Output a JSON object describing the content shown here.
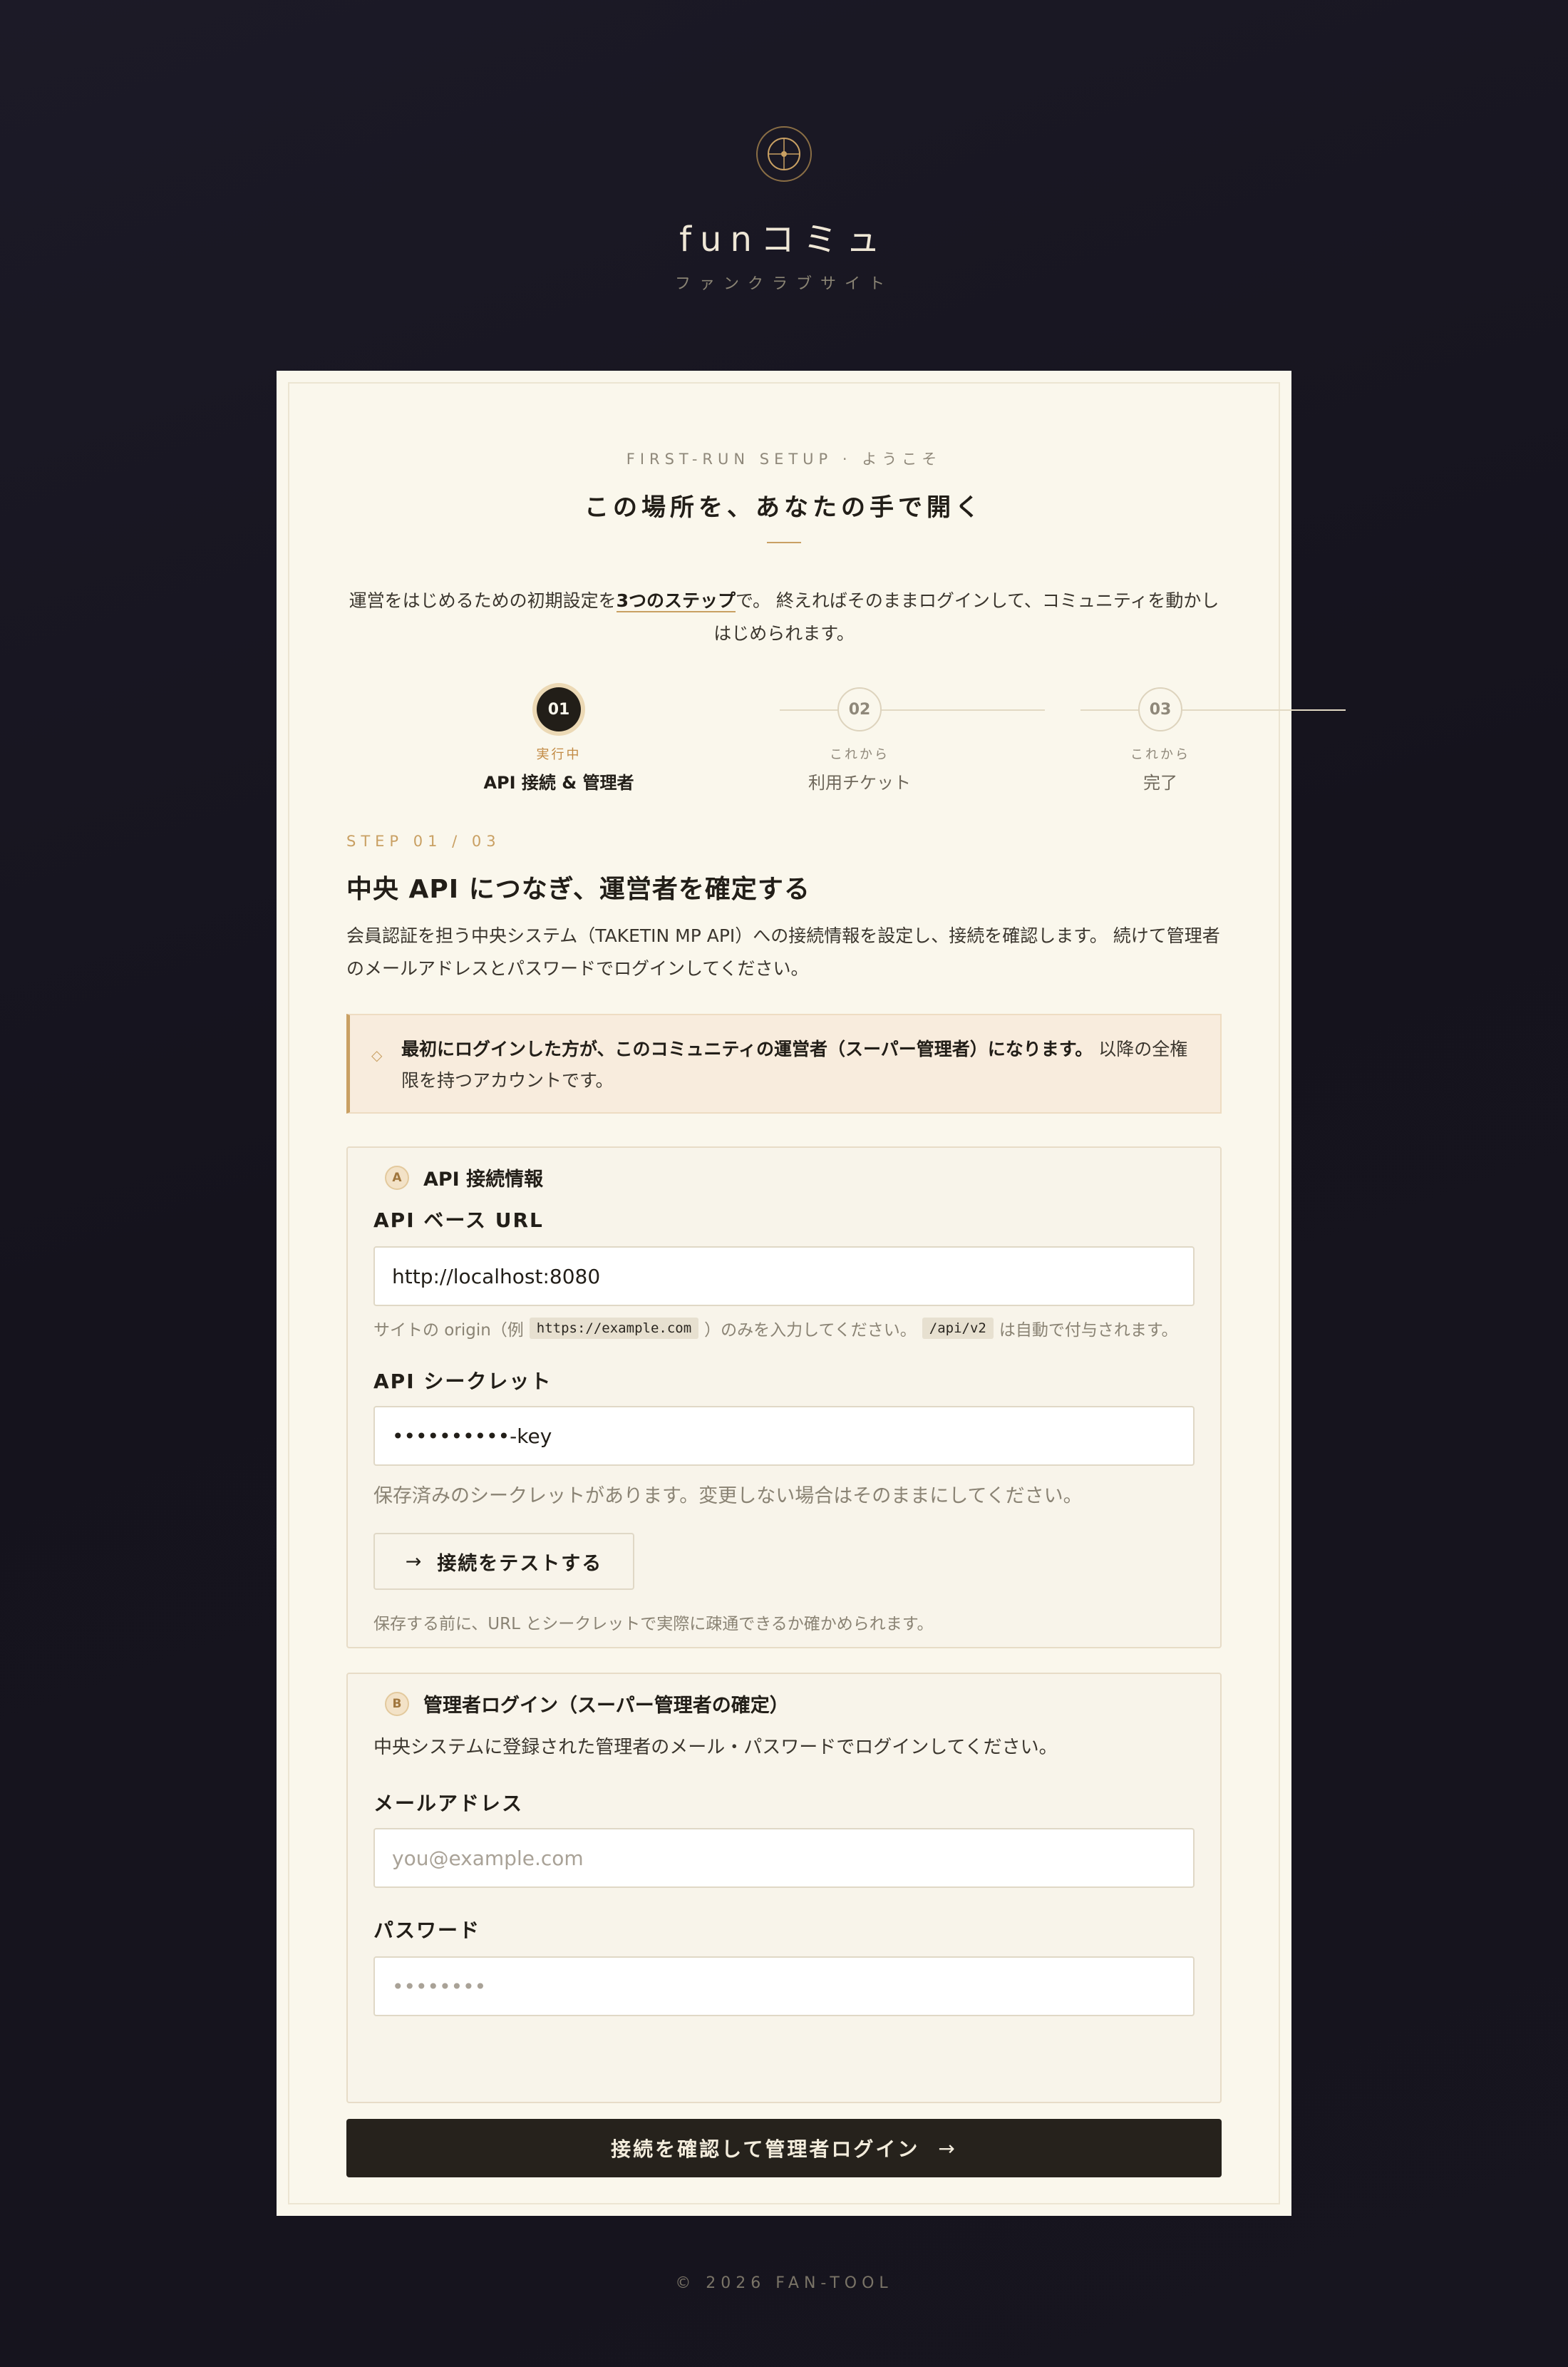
{
  "brand": {
    "name": "funコミュ",
    "subtitle": "ファンクラブサイト",
    "logo_icon": "crosshair-circle-icon"
  },
  "header": {
    "eyebrow": "FIRST-RUN SETUP · ようこそ",
    "title": "この場所を、あなたの手で開く",
    "intro_before": "運営をはじめるための初期設定を",
    "intro_strong": "3つのステップ",
    "intro_after": "で。 終えればそのままログインして、コミュニティを動かしはじめられます。"
  },
  "steps": [
    {
      "number": "01",
      "state": "実行中",
      "label": "API 接続 & 管理者",
      "active": true
    },
    {
      "number": "02",
      "state": "これから",
      "label": "利用チケット",
      "active": false
    },
    {
      "number": "03",
      "state": "これから",
      "label": "完了",
      "active": false
    }
  ],
  "section": {
    "step_label": "STEP 01 / 03",
    "title": "中央 API につなぎ、運営者を確定する",
    "description": "会員認証を担う中央システム（TAKETIN MP API）への接続情報を設定し、接続を確認します。 続けて管理者のメールアドレスとパスワードでログインしてください。"
  },
  "notice": {
    "icon": "diamond-icon",
    "strong": "最初にログインした方が、このコミュニティの運営者（スーパー管理者）になります。",
    "text": " 以降の全権限を持つアカウントです。"
  },
  "api_panel": {
    "badge": "A",
    "title": "API 接続情報",
    "base_url_label": "API ベース URL",
    "base_url_value": "http://localhost:8080",
    "hint_before": "サイトの origin（例",
    "hint_code1": "https://example.com",
    "hint_middle": "）のみを入力してください。",
    "hint_code2": "/api/v2",
    "hint_after": "は自動で付与されます。",
    "secret_label": "API シークレット",
    "secret_value": "••••••••••-key",
    "secret_hint": "保存済みのシークレットがあります。変更しない場合はそのままにしてください。",
    "test_button": "接続をテストする",
    "test_icon": "arrow-right-icon",
    "test_hint": "保存する前に、URL とシークレットで実際に疎通できるか確かめられます。"
  },
  "admin_panel": {
    "badge": "B",
    "title": "管理者ログイン（スーパー管理者の確定）",
    "description": "中央システムに登録された管理者のメール・パスワードでログインしてください。",
    "email_label": "メールアドレス",
    "email_placeholder": "you@example.com",
    "password_label": "パスワード",
    "password_placeholder": "••••••••"
  },
  "submit": {
    "label": "接続を確認して管理者ログイン",
    "icon": "arrow-right-icon"
  },
  "footer": {
    "text": "© 2026 FAN-TOOL"
  },
  "colors": {
    "accent": "#c9a063",
    "dark": "#221e18",
    "card": "#faf7ec",
    "background": "#17151f"
  }
}
